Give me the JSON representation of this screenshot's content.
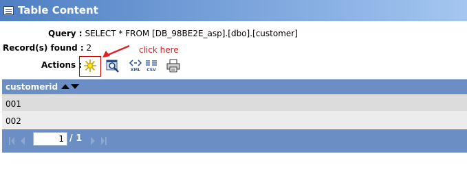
{
  "panel": {
    "title": "Table Content",
    "title_icon": "table-icon"
  },
  "query": {
    "label": "Query :",
    "value": "SELECT * FROM [DB_98BE2E_asp].[dbo].[customer]"
  },
  "records": {
    "label": "Record(s) found :",
    "value": "2"
  },
  "actions": {
    "label": "Actions :",
    "items": [
      "new-record-icon",
      "search-icon",
      "export-xml-icon",
      "export-csv-icon",
      "print-icon"
    ],
    "icon_text_xml": "XML",
    "icon_text_csv": "CSV"
  },
  "hint": {
    "text": "click here",
    "color": "#d02020"
  },
  "table": {
    "columns": [
      "customerid"
    ],
    "rows": [
      [
        "001"
      ],
      [
        "002"
      ]
    ]
  },
  "pager": {
    "current_page": "1",
    "total": "/ 1"
  },
  "colors": {
    "header_bg": "#6b8fc4",
    "row_odd": "#dcdcdc",
    "row_even": "#ececec",
    "title_bg": "#4f7fc2"
  }
}
